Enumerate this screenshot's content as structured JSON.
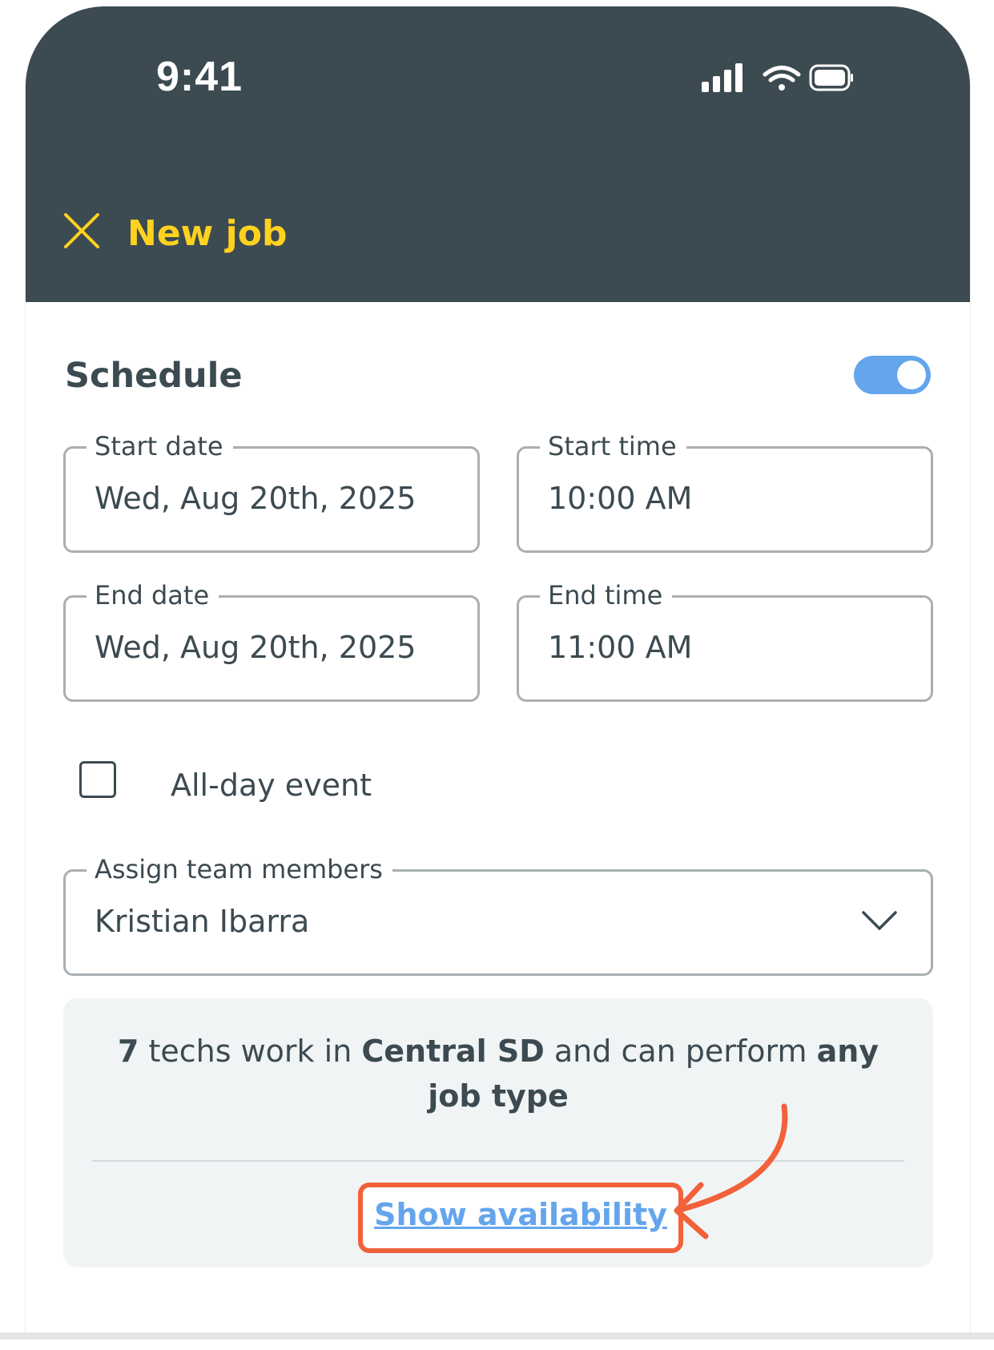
{
  "status_bar": {
    "time": "9:41",
    "icons": [
      "signal-icon",
      "wifi-icon",
      "battery-icon"
    ]
  },
  "header": {
    "title": "New job",
    "close_icon": "close-icon",
    "background": "#3c4a51",
    "accent": "#ffd21f"
  },
  "schedule": {
    "title": "Schedule",
    "toggle_on": true,
    "toggle_color": "#64a5ec",
    "start_date": {
      "label": "Start date",
      "value": "Wed, Aug 20th, 2025"
    },
    "start_time": {
      "label": "Start time",
      "value": "10:00 AM"
    },
    "end_date": {
      "label": "End date",
      "value": "Wed, Aug 20th, 2025"
    },
    "end_time": {
      "label": "End time",
      "value": "11:00 AM"
    },
    "all_day": {
      "label": "All-day event",
      "checked": false
    },
    "assign": {
      "label": "Assign team members",
      "value": "Kristian Ibarra"
    }
  },
  "info": {
    "count": "7",
    "text_1": " techs work in ",
    "region": "Central SD",
    "text_2": " and can perform ",
    "job_types": "any job type",
    "link_label": "Show availability",
    "highlight_color": "#f2613a"
  }
}
